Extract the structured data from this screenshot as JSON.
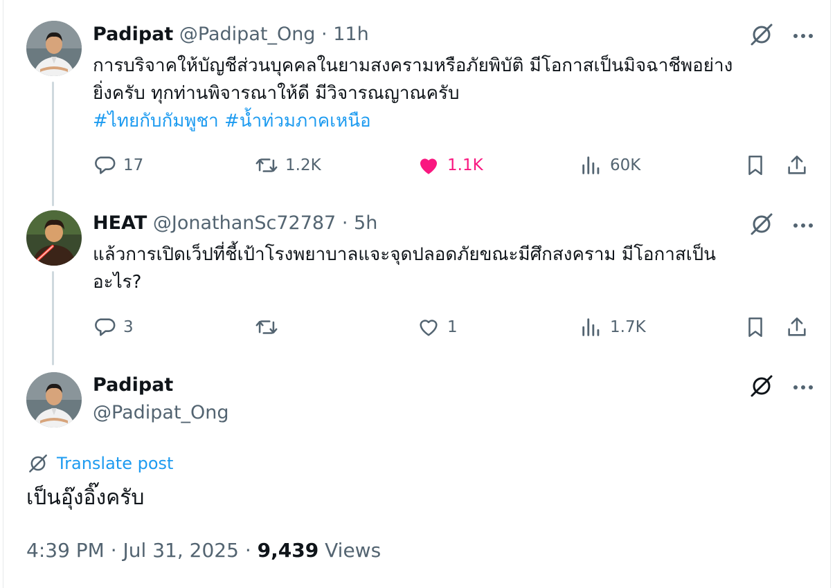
{
  "tweets": [
    {
      "name": "Padipat",
      "handle": "@Padipat_Ong",
      "time": "11h",
      "text": "การบริจาคให้บัญชีส่วนบุคคลในยามสงครามหรือภัยพิบัติ มีโอกาสเป็นมิจฉาชีพอย่าง",
      "text2": "ยิ่งครับ ทุกท่านพิจารณาให้ดี มีวิจารณญาณครับ",
      "hashtags": [
        "#ไทยกับกัมพูชา",
        "#น้ำท่วมภาคเหนือ"
      ],
      "replies": "17",
      "reposts": "1.2K",
      "likes": "1.1K",
      "views": "60K",
      "liked": true
    },
    {
      "name": "HEAT",
      "handle": "@JonathanSc72787",
      "time": "5h",
      "text": "แล้วการเปิดเว็ปที่ชี้เป้าโรงพยาบาลแจะจุดปลอดภัยขณะมีศึกสงคราม มีโอกาสเป็น",
      "text2": "อะไร?",
      "replies": "3",
      "reposts": "",
      "likes": "1",
      "views": "1.7K",
      "liked": false
    }
  ],
  "main": {
    "name": "Padipat",
    "handle": "@Padipat_Ong",
    "translate": "Translate post",
    "text": "เป็นอุ๊งอิ๊งครับ",
    "time": "4:39 PM",
    "date": "Jul 31, 2025",
    "views_count": "9,439",
    "views_label": "Views"
  },
  "icons": {
    "reply": "reply-icon",
    "repost": "repost-icon",
    "like": "heart-icon",
    "views": "views-icon",
    "bookmark": "bookmark-icon",
    "share": "share-icon",
    "grok": "grok-icon",
    "more": "more-icon"
  },
  "colors": {
    "accent": "#1d9bf0",
    "like": "#f91880",
    "muted": "#536471",
    "text": "#0f1419",
    "thread": "#cfd9de"
  }
}
